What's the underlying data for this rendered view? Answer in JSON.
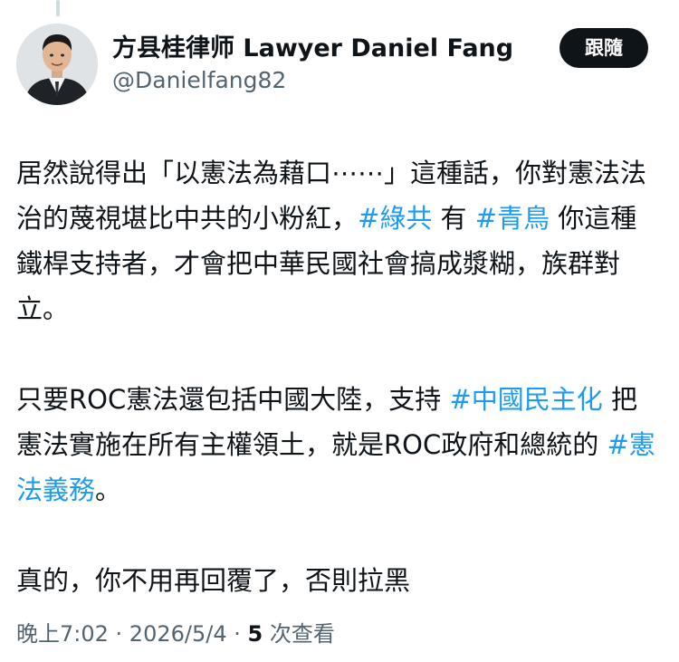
{
  "author": {
    "name": "方县桂律师 Lawyer Daniel Fang",
    "handle": "@Danielfang82"
  },
  "follow_label": "跟隨",
  "tweet": {
    "p1": {
      "t1": "居然說得出「以憲法為藉口⋯⋯」這種話，你對憲法法治的蔑視堪比中共的小粉紅，",
      "h1": "#綠共",
      "t2": " 有 ",
      "h2": "#青鳥",
      "t3": " 你這種鐵桿支持者，才會把中華民國社會搞成漿糊，族群對立。"
    },
    "p2": {
      "t1": "只要ROC憲法還包括中國大陸，支持 ",
      "h1": "#中國民主化",
      "t2": " 把憲法實施在所有主權領土，就是ROC政府和總統的 ",
      "h2": "#憲法義務",
      "t3": "。"
    },
    "p3": "真的，你不用再回覆了，否則拉黑"
  },
  "meta": {
    "time": "晚上7:02",
    "sep1": " · ",
    "date": "2026/5/4",
    "sep2": " · ",
    "views_count": "5",
    "views_label": " 次查看"
  },
  "colors": {
    "hashtag": "#1d9bf0",
    "follow_bg": "#0f1419",
    "secondary_text": "#536471"
  }
}
